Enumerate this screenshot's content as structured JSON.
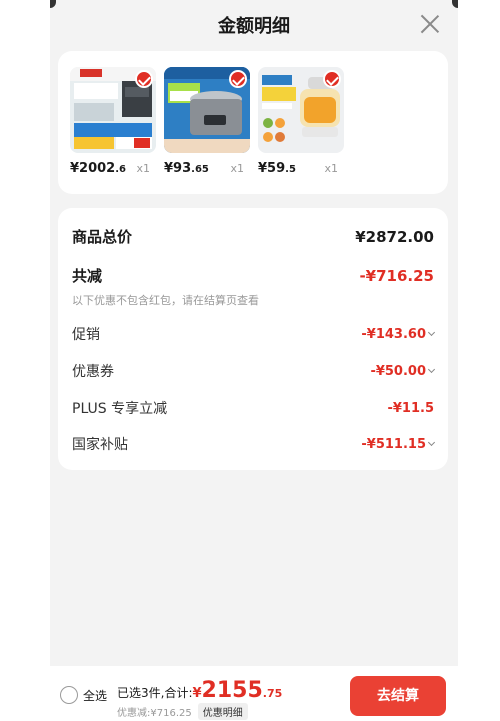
{
  "header": {
    "title": "金额明细"
  },
  "products": [
    {
      "price_int": "¥2002",
      "price_dec": ".6",
      "qty": "x1",
      "thumb_name": "range-hood-thumbnail"
    },
    {
      "price_int": "¥93",
      "price_dec": ".65",
      "qty": "x1",
      "thumb_name": "rice-cooker-thumbnail"
    },
    {
      "price_int": "¥59",
      "price_dec": ".5",
      "qty": "x1",
      "thumb_name": "food-processor-thumbnail"
    }
  ],
  "summary": {
    "goods_total_label": "商品总价",
    "goods_total_value": "¥2872.00",
    "total_reduce_label": "共减",
    "total_reduce_value": "-¥716.25",
    "note": "以下优惠不包含红包，请在结算页查看",
    "promo_label": "促销",
    "promo_value": "-¥143.60",
    "coupon_label": "优惠券",
    "coupon_value": "-¥50.00",
    "plus_label": "PLUS 专享立减",
    "plus_value": "-¥11.5",
    "subsidy_label": "国家补贴",
    "subsidy_value": "-¥511.15"
  },
  "footer": {
    "select_all": "全选",
    "selected_text": "已选3件,合计:",
    "total_prefix": "¥",
    "total_int": "2155",
    "total_dec": ".75",
    "discount_text": "优惠减:¥716.25",
    "detail_tag": "优惠明细",
    "checkout": "去结算"
  },
  "colors": {
    "accent": "#e02e24",
    "checkout_button": "#ea4134"
  }
}
